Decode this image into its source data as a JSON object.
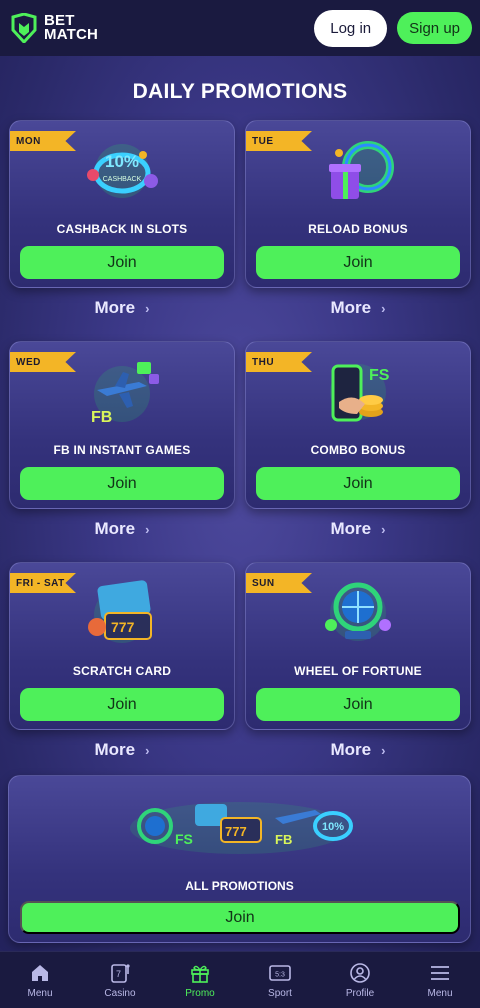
{
  "header": {
    "logo_line1": "BET",
    "logo_line2": "MATCH",
    "login_label": "Log in",
    "signup_label": "Sign up"
  },
  "page_title": "DAILY PROMOTIONS",
  "cards": [
    {
      "day": "MON",
      "title": "CASHBACK IN SLOTS",
      "join": "Join",
      "more": "More"
    },
    {
      "day": "TUE",
      "title": "RELOAD BONUS",
      "join": "Join",
      "more": "More"
    },
    {
      "day": "WED",
      "title": "FB IN INSTANT GAMES",
      "join": "Join",
      "more": "More"
    },
    {
      "day": "THU",
      "title": "COMBO BONUS",
      "join": "Join",
      "more": "More"
    },
    {
      "day": "FRI - SAT",
      "title": "SCRATCH CARD",
      "join": "Join",
      "more": "More"
    },
    {
      "day": "SUN",
      "title": "WHEEL OF FORTUNE",
      "join": "Join",
      "more": "More"
    }
  ],
  "all_promotions": {
    "title": "ALL PROMOTIONS",
    "join": "Join"
  },
  "art_text": {
    "cashback": "10%",
    "fb": "FB",
    "fs": "FS",
    "score": "5:3"
  },
  "nav": [
    {
      "label": "Menu",
      "icon": "home-icon"
    },
    {
      "label": "Casino",
      "icon": "slot-icon"
    },
    {
      "label": "Promo",
      "icon": "gift-icon",
      "active": true
    },
    {
      "label": "Sport",
      "icon": "scoreboard-icon"
    },
    {
      "label": "Profile",
      "icon": "profile-icon"
    },
    {
      "label": "Menu",
      "icon": "hamburger-icon"
    }
  ],
  "colors": {
    "accent_green": "#4ef05a",
    "tag_yellow": "#f3b526",
    "header_bg": "#1a1a40"
  }
}
